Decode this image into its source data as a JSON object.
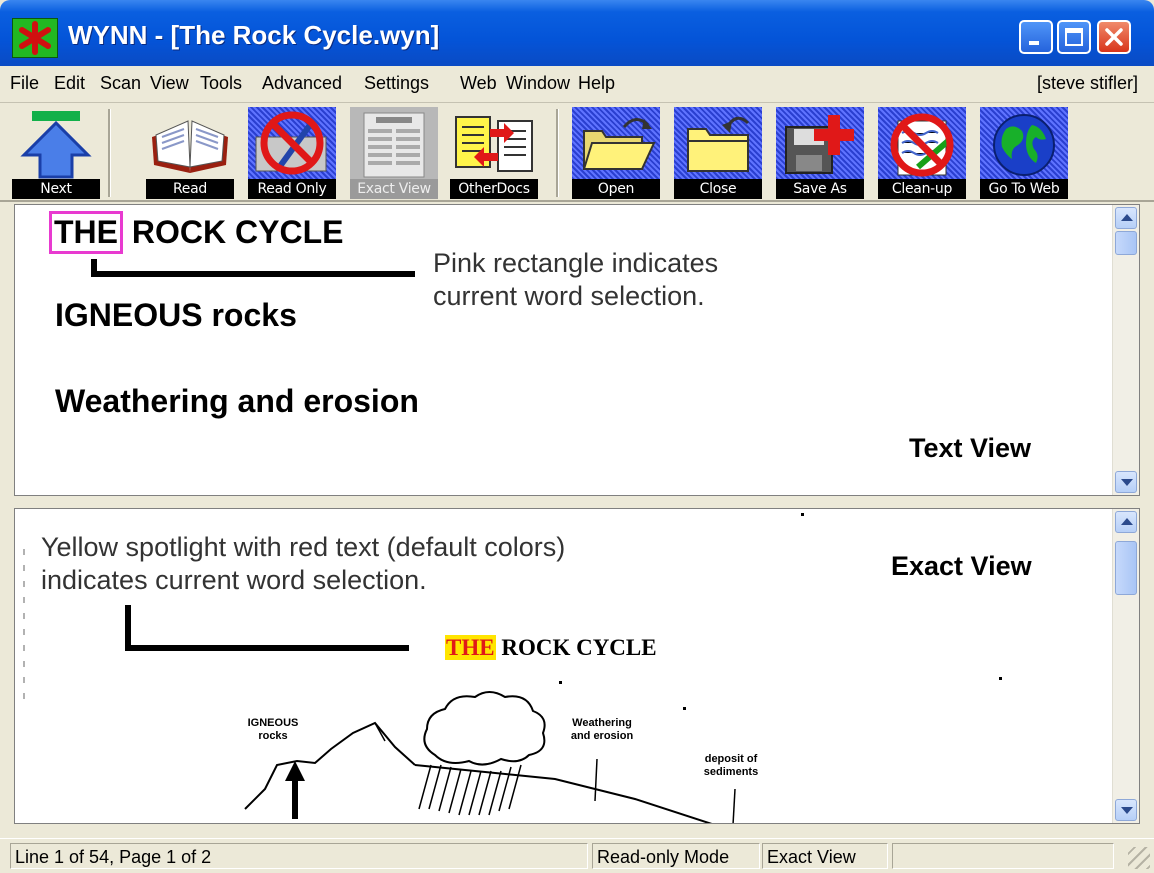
{
  "window": {
    "title": "WYNN - [The Rock Cycle.wyn]",
    "app_icon": "red-asterisk-icon",
    "controls": [
      "minimize-icon",
      "maximize-icon",
      "close-icon"
    ]
  },
  "menu": {
    "items": [
      "File",
      "Edit",
      "Scan",
      "View",
      "Tools",
      "Advanced",
      "Settings",
      "Web",
      "Window",
      "Help"
    ],
    "user": "[steve stifler]"
  },
  "toolbar": {
    "buttons": [
      {
        "label": "Next",
        "icon": "next-arrow-icon"
      },
      {
        "label": "Read",
        "icon": "open-book-icon"
      },
      {
        "label": "Read Only",
        "icon": "no-edit-icon",
        "checked": true
      },
      {
        "label": "Exact View",
        "icon": "exact-view-icon"
      },
      {
        "label": "OtherDocs",
        "icon": "other-docs-icon"
      },
      {
        "label": "Open",
        "icon": "open-folder-icon",
        "checked": true
      },
      {
        "label": "Close",
        "icon": "close-folder-icon",
        "checked": true
      },
      {
        "label": "Save As",
        "icon": "save-as-icon",
        "checked": true
      },
      {
        "label": "Clean-up",
        "icon": "clean-up-icon",
        "checked": true
      },
      {
        "label": "Go To Web",
        "icon": "globe-icon",
        "checked": true
      }
    ]
  },
  "text_view": {
    "title_selected_word": "THE",
    "title_rest": "ROCK CYCLE",
    "line2": "IGNEOUS rocks",
    "line3": "Weathering and erosion",
    "annotation_line1": "Pink rectangle indicates",
    "annotation_line2": "current word selection.",
    "view_label": "Text View",
    "colors": {
      "selection_border": "#e83ad0"
    }
  },
  "exact_view": {
    "annotation_line1": "Yellow spotlight with red text (default colors)",
    "annotation_line2": "indicates current word selection.",
    "view_label": "Exact View",
    "title_selected_word": "THE",
    "title_rest": "ROCK CYCLE",
    "sketch_labels": {
      "igneous_1": "IGNEOUS",
      "igneous_2": "rocks",
      "weathering_1": "Weathering",
      "weathering_2": "and erosion",
      "deposit_1": "deposit of",
      "deposit_2": "sediments"
    },
    "colors": {
      "spotlight": "#ffe500",
      "spotlight_text": "#e01818"
    }
  },
  "status": {
    "position": "Line 1 of 54, Page 1 of 2",
    "mode": "Read-only Mode",
    "view": "Exact View",
    "extra": ""
  }
}
